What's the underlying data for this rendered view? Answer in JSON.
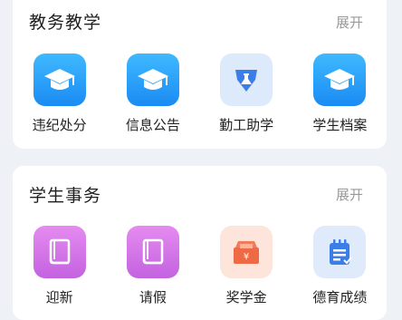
{
  "sections": [
    {
      "title": "教务教学",
      "expand_label": "展开",
      "items": [
        {
          "label": "违纪处分",
          "icon": "graduation-cap-icon"
        },
        {
          "label": "信息公告",
          "icon": "graduation-cap-icon"
        },
        {
          "label": "勤工助学",
          "icon": "flask-icon"
        },
        {
          "label": "学生档案",
          "icon": "graduation-cap-icon"
        }
      ]
    },
    {
      "title": "学生事务",
      "expand_label": "展开",
      "items": [
        {
          "label": "迎新",
          "icon": "book-icon"
        },
        {
          "label": "请假",
          "icon": "book-icon"
        },
        {
          "label": "奖学金",
          "icon": "money-box-icon"
        },
        {
          "label": "德育成绩",
          "icon": "notepad-icon"
        }
      ]
    }
  ],
  "colors": {
    "blue": "#1a8bf3",
    "purple": "#c462e0",
    "orange": "#ee6a45",
    "icon_blue": "#3c7ee8"
  }
}
